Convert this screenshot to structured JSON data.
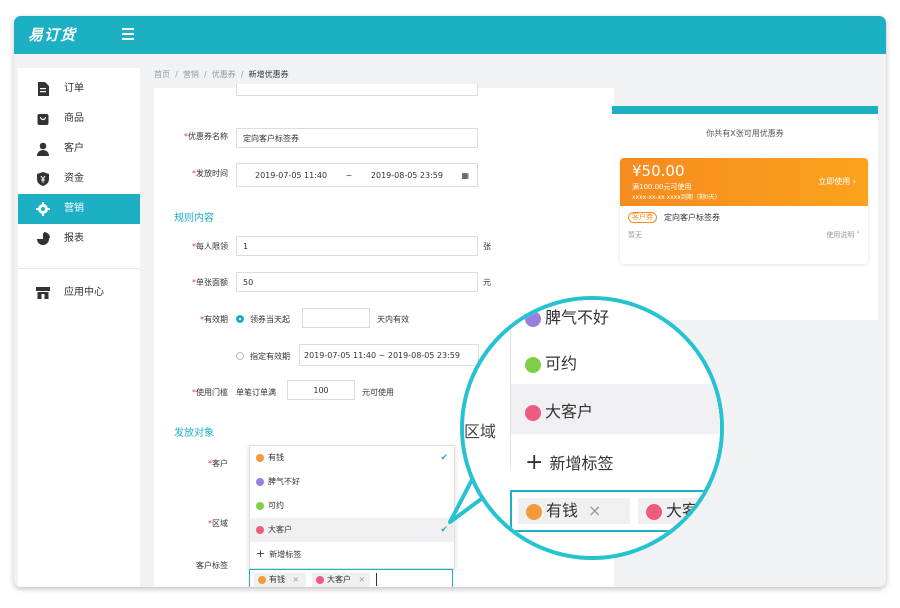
{
  "app": {
    "logo_text": "易订货"
  },
  "sidebar": {
    "items": [
      {
        "label": "订单",
        "icon": "document-icon"
      },
      {
        "label": "商品",
        "icon": "bag-icon"
      },
      {
        "label": "客户",
        "icon": "user-icon"
      },
      {
        "label": "资金",
        "icon": "shield-yen-icon"
      },
      {
        "label": "营销",
        "icon": "gear-icon"
      },
      {
        "label": "报表",
        "icon": "pie-chart-icon"
      },
      {
        "label": "应用中心",
        "icon": "store-icon"
      }
    ],
    "active_index": 4
  },
  "breadcrumb": {
    "items": [
      "首页",
      "营销",
      "优惠券"
    ],
    "current": "新增优惠券",
    "sep": "/"
  },
  "form": {
    "coupon_name_label": "优惠券名称",
    "coupon_name_value": "定向客户标签券",
    "issue_time_label": "发放时间",
    "issue_start": "2019-07-05 11:40",
    "issue_tilde": "~",
    "issue_end": "2019-08-05 23:59",
    "rules_title": "规则内容",
    "per_person_label": "每人限领",
    "per_person_value": "1",
    "per_person_unit": "张",
    "face_value_label": "单张面额",
    "face_value_value": "50",
    "face_value_unit": "元",
    "validity_label": "有效期",
    "validity_opt1": "领券当天起",
    "validity_opt1_suffix": "天内有效",
    "validity_opt2": "指定有效期",
    "validity_range": "2019-07-05 11:40 ~ 2019-08-05 23:59",
    "threshold_label": "使用门槛",
    "threshold_prefix": "单笔订单满",
    "threshold_value": "100",
    "threshold_suffix": "元可使用",
    "target_title": "发放对象",
    "customer_label": "客户",
    "region_label": "区域",
    "tags_label": "客户标签"
  },
  "dropdown": {
    "items": [
      {
        "label": "有钱",
        "color": "#f39a3c",
        "checked": true
      },
      {
        "label": "脾气不好",
        "color": "#9b7fe0",
        "checked": false
      },
      {
        "label": "可约",
        "color": "#7fcf4a",
        "checked": false
      },
      {
        "label": "大客户",
        "color": "#ee5b7f",
        "checked": true
      }
    ],
    "add_label": "新增标签"
  },
  "selected_tags": [
    {
      "label": "有钱",
      "color": "#f39a3c"
    },
    {
      "label": "大客户",
      "color": "#ee5b7f"
    }
  ],
  "preview": {
    "header": "你共有X张可用优惠券",
    "amount": "¥50.00",
    "condition": "满100.00元可使用",
    "expiry": "xxxx-xx-xx xxxx到期（剩0天）",
    "use_now": "立即使用 ›",
    "badge": "客户券",
    "coupon_name": "定向客户标签券",
    "no_desc": "暂无",
    "usage_desc": "使用说明 ˄"
  },
  "magnifier": {
    "items": [
      {
        "label": "脾气不好",
        "color": "#9b7fe0"
      },
      {
        "label": "可约",
        "color": "#7fcf4a"
      },
      {
        "label": "大客户",
        "color": "#ee5b7f"
      }
    ],
    "add_label": "新增标签",
    "outside_text": "区域",
    "tags": [
      {
        "label": "有钱",
        "color": "#f39a3c"
      },
      {
        "label": "大客户",
        "color": "#ee5b7f"
      }
    ]
  },
  "colors": {
    "accent": "#1db0c5",
    "required": "#e4393c",
    "coupon_orange": "#f68b1f"
  }
}
